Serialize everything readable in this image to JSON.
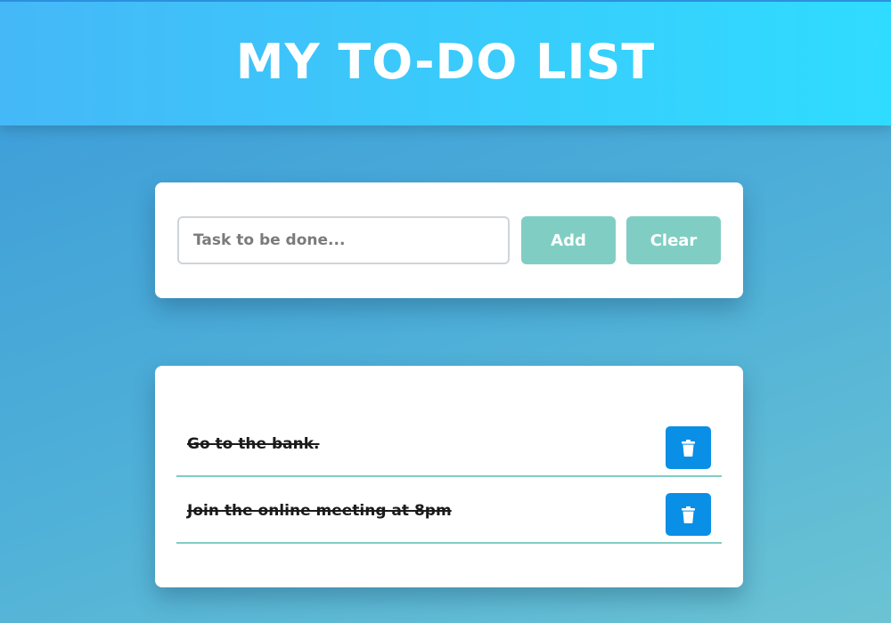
{
  "header": {
    "title": "MY TO-DO LIST"
  },
  "form": {
    "input_placeholder": "Task to be done...",
    "input_value": "",
    "add_label": "Add",
    "clear_label": "Clear"
  },
  "todos": [
    {
      "text": "Go to the bank.",
      "completed": true,
      "delete_icon": "trash-icon"
    },
    {
      "text": "Join the online meeting at 8pm",
      "completed": true,
      "delete_icon": "trash-icon"
    }
  ],
  "colors": {
    "header_gradient_start": "#45b8f7",
    "header_gradient_end": "#2fdcff",
    "button_accent": "#80cec3",
    "delete_button": "#0a8fe6",
    "item_divider": "#80cec3"
  }
}
